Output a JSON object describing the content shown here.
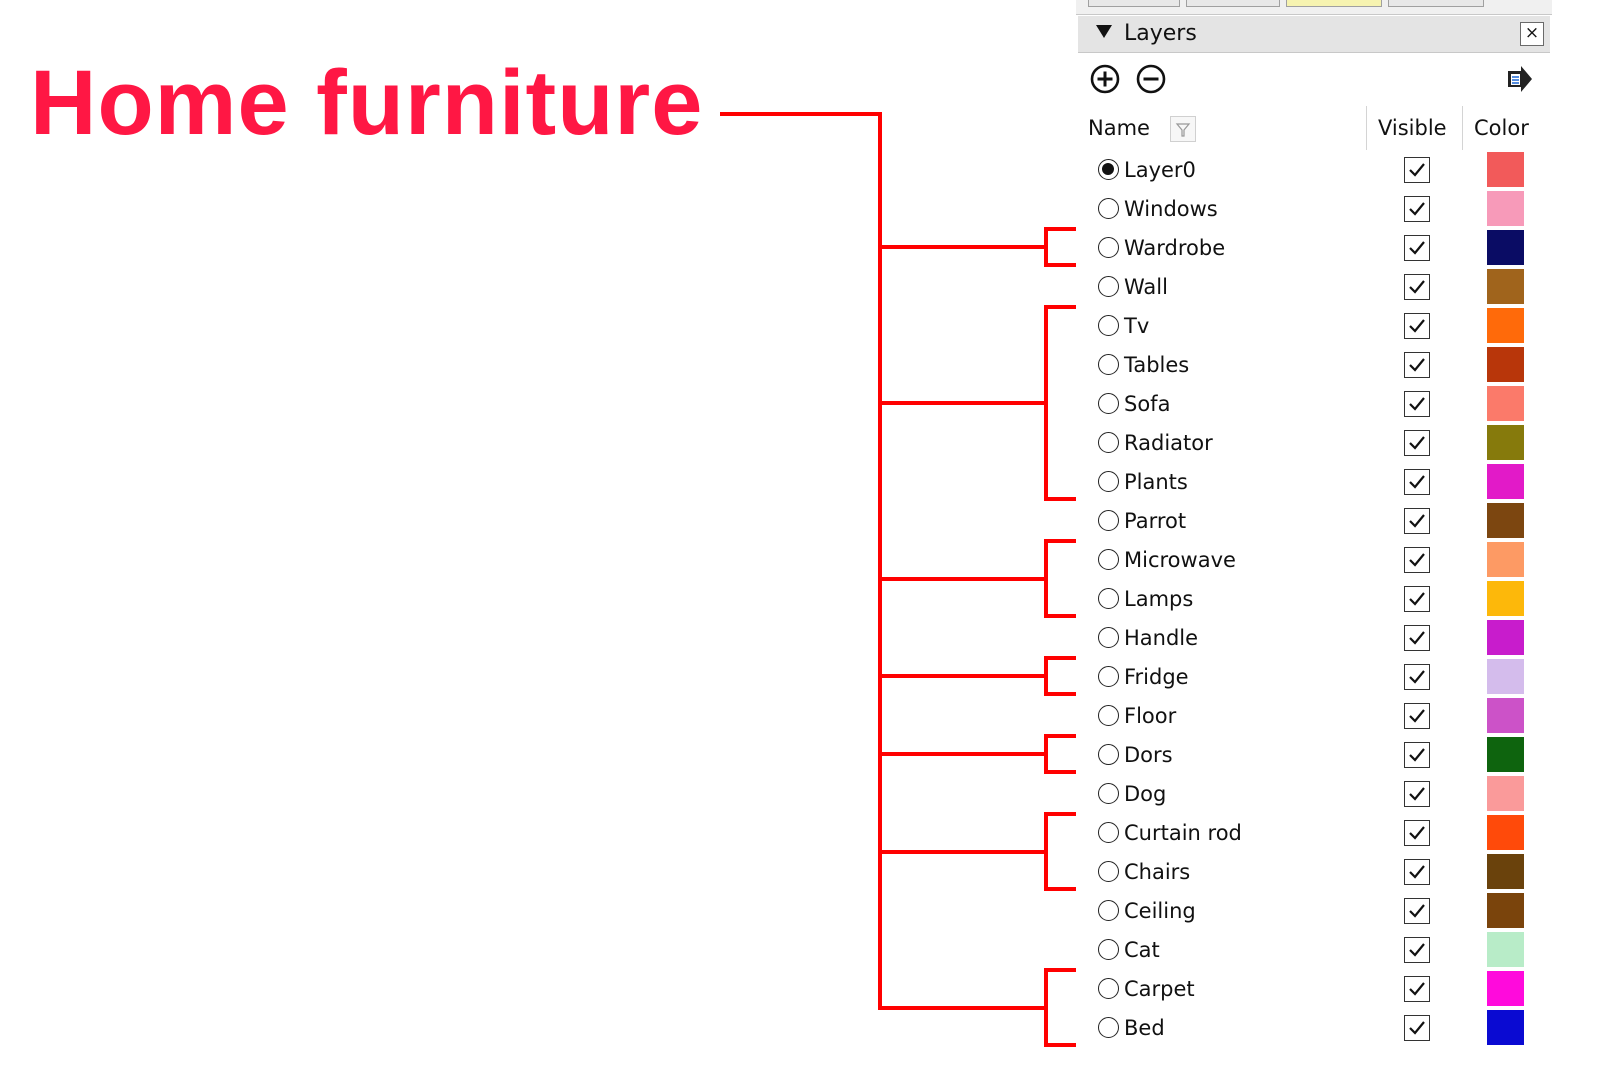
{
  "annotation": {
    "title": "Home furniture",
    "title_color": "#ff1744",
    "highlight_color": "#ff0000",
    "highlighted_layers": [
      "Wardrobe",
      "Tv",
      "Tables",
      "Sofa",
      "Radiator",
      "Plants",
      "Microwave",
      "Lamps",
      "Fridge",
      "Dors",
      "Curtain rod",
      "Chairs",
      "Carpet",
      "Bed"
    ]
  },
  "panel": {
    "title": "Layers",
    "close_label": "×",
    "toolbar": {
      "add_icon": "add-layer-icon",
      "remove_icon": "remove-layer-icon",
      "details_icon": "details-arrow-icon"
    },
    "columns": {
      "name": "Name",
      "visible": "Visible",
      "color": "Color"
    },
    "layers": [
      {
        "name": "Layer0",
        "active": true,
        "visible": true,
        "color": "#f25a5a"
      },
      {
        "name": "Windows",
        "active": false,
        "visible": true,
        "color": "#f79ab9"
      },
      {
        "name": "Wardrobe",
        "active": false,
        "visible": true,
        "color": "#0a0c64"
      },
      {
        "name": "Wall",
        "active": false,
        "visible": true,
        "color": "#a0641c"
      },
      {
        "name": "Tv",
        "active": false,
        "visible": true,
        "color": "#ff6a0a"
      },
      {
        "name": "Tables",
        "active": false,
        "visible": true,
        "color": "#b8360a"
      },
      {
        "name": "Sofa",
        "active": false,
        "visible": true,
        "color": "#fb7a6a"
      },
      {
        "name": "Radiator",
        "active": false,
        "visible": true,
        "color": "#867a0c"
      },
      {
        "name": "Plants",
        "active": false,
        "visible": true,
        "color": "#e21ac8"
      },
      {
        "name": "Parrot",
        "active": false,
        "visible": true,
        "color": "#7c4610"
      },
      {
        "name": "Microwave",
        "active": false,
        "visible": true,
        "color": "#fd9a64"
      },
      {
        "name": "Lamps",
        "active": false,
        "visible": true,
        "color": "#fdb80a"
      },
      {
        "name": "Handle",
        "active": false,
        "visible": true,
        "color": "#c81ccc"
      },
      {
        "name": "Fridge",
        "active": false,
        "visible": true,
        "color": "#d4bcec"
      },
      {
        "name": "Floor",
        "active": false,
        "visible": true,
        "color": "#cc52c8"
      },
      {
        "name": "Dors",
        "active": false,
        "visible": true,
        "color": "#0e640e"
      },
      {
        "name": "Dog",
        "active": false,
        "visible": true,
        "color": "#fa9a9a"
      },
      {
        "name": "Curtain rod",
        "active": false,
        "visible": true,
        "color": "#ff4a0a"
      },
      {
        "name": "Chairs",
        "active": false,
        "visible": true,
        "color": "#6a420c"
      },
      {
        "name": "Ceiling",
        "active": false,
        "visible": true,
        "color": "#7a440c"
      },
      {
        "name": "Cat",
        "active": false,
        "visible": true,
        "color": "#b8ecc8"
      },
      {
        "name": "Carpet",
        "active": false,
        "visible": true,
        "color": "#ff0adc"
      },
      {
        "name": "Bed",
        "active": false,
        "visible": true,
        "color": "#0a0ad2"
      }
    ]
  }
}
